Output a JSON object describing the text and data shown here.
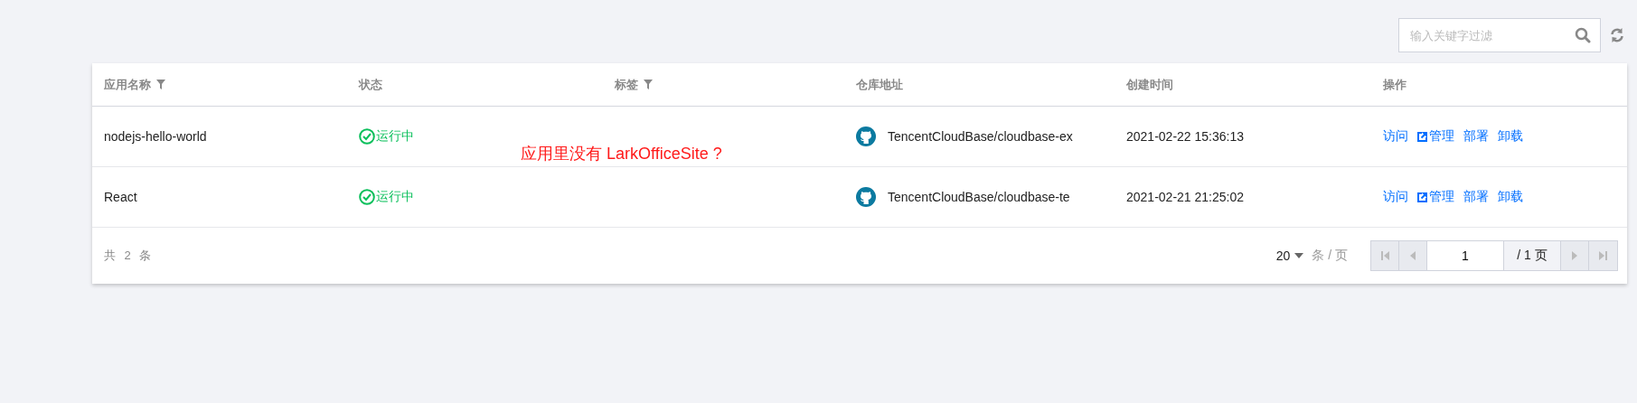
{
  "search": {
    "placeholder": "输入关键字过滤"
  },
  "table": {
    "columns": [
      {
        "label": "应用名称",
        "filter": true
      },
      {
        "label": "状态",
        "filter": false
      },
      {
        "label": "标签",
        "filter": true
      },
      {
        "label": "仓库地址",
        "filter": false
      },
      {
        "label": "创建时间",
        "filter": false
      },
      {
        "label": "操作",
        "filter": false
      }
    ],
    "rows": [
      {
        "name": "nodejs-hello-world",
        "status": {
          "kind": "running",
          "label": "运行中"
        },
        "repo": "TencentCloudBase/cloudbase-ex",
        "created": "2021-02-22 15:36:13",
        "actions": [
          {
            "label": "访问",
            "external": false
          },
          {
            "label": "管理",
            "external": true
          },
          {
            "label": "部署",
            "external": false
          },
          {
            "label": "卸载",
            "external": false
          }
        ]
      },
      {
        "name": "React",
        "status": {
          "kind": "running",
          "label": "运行中"
        },
        "repo": "TencentCloudBase/cloudbase-te",
        "created": "2021-02-21 21:25:02",
        "actions": [
          {
            "label": "访问",
            "external": false
          },
          {
            "label": "管理",
            "external": true
          },
          {
            "label": "部署",
            "external": false
          },
          {
            "label": "卸载",
            "external": false
          }
        ]
      }
    ]
  },
  "annotation": "应用里没有 LarkOfficeSite ?",
  "footer": {
    "total": "共 2 条",
    "page_size": "20",
    "page_size_unit": "条 / 页",
    "page": "1",
    "page_total": "/ 1 页"
  }
}
